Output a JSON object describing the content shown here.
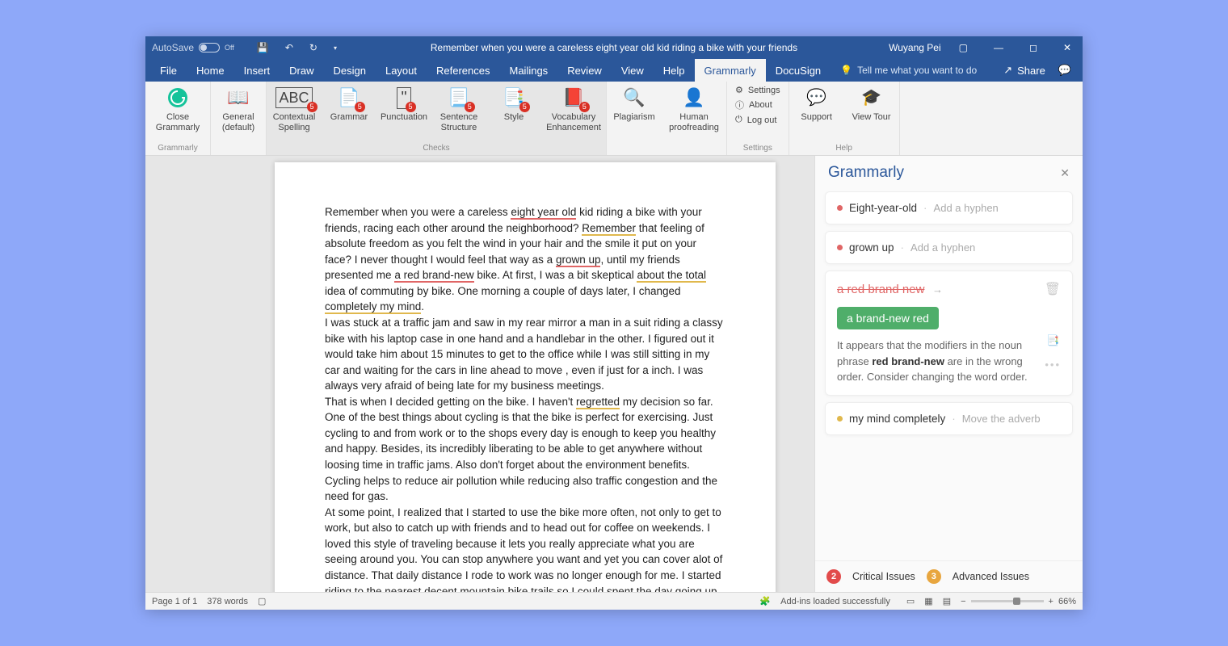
{
  "titlebar": {
    "autosave_label": "AutoSave",
    "autosave_state": "Off",
    "doc_title": "Remember when you were a careless eight year old kid riding a bike with your friends",
    "user_name": "Wuyang Pei"
  },
  "tabs": {
    "file": "File",
    "home": "Home",
    "insert": "Insert",
    "draw": "Draw",
    "design": "Design",
    "layout": "Layout",
    "references": "References",
    "mailings": "Mailings",
    "review": "Review",
    "view": "View",
    "help": "Help",
    "grammarly": "Grammarly",
    "docusign": "DocuSign",
    "tellme": "Tell me what you want to do",
    "share": "Share"
  },
  "ribbon": {
    "close_grammarly": "Close Grammarly",
    "grammarly_group": "Grammarly",
    "general_default": "General (default)",
    "contextual_spelling": "Contextual Spelling",
    "grammar": "Grammar",
    "punctuation": "Punctuation",
    "sentence_structure": "Sentence Structure",
    "style": "Style",
    "vocabulary_enhancement": "Vocabulary Enhancement",
    "checks_group": "Checks",
    "plagiarism": "Plagiarism",
    "human_proofreading": "Human proofreading",
    "settings": "Settings",
    "about": "About",
    "logout": "Log out",
    "settings_group": "Settings",
    "support": "Support",
    "view_tour": "View Tour",
    "help_group": "Help",
    "badges": {
      "contextual": "5",
      "grammar": "5",
      "punctuation": "5",
      "sentence": "5",
      "style": "5",
      "vocab": "5"
    }
  },
  "document": {
    "p1a": "Remember when you were a careless ",
    "p1_err1": "eight year old",
    "p1b": " kid riding a bike with your friends, racing each other around the neighborhood? ",
    "p1_err2": "Remember",
    "p1c": " that feeling of absolute freedom as you felt the wind in your hair and the smile it put on your face? I never thought I would feel that way as a ",
    "p1_err3": "grown up",
    "p1d": ", until my friends presented me ",
    "p1_err4": "a red brand-new",
    "p1e": " bike. At first, I was a bit skeptical ",
    "p1_err5": "about the total",
    "p1f": " idea of commuting by bike. One morning a couple of days later, I changed ",
    "p1_err6": "completely my mind",
    "p1g": ".",
    "p2": "I was stuck at a traffic jam and saw in my rear mirror a man in a suit riding a classy bike with his laptop case in one hand and a handlebar in the other. I figured out it would take him about 15 minutes to get to the office while I was still sitting in my car and waiting for the cars in line ahead to move , even if just for a inch. I was always very afraid of being late for my business meetings.",
    "p3a": "That is when I decided getting on the bike. I haven't ",
    "p3_err": "regretted",
    "p3b": " my decision so far. One of the best things about cycling is that the bike is perfect for exercising. Just cycling to and from work or to the shops every day is enough to keep you healthy and happy. Besides, its incredibly liberating to be able to get anywhere without loosing time in traffic jams. Also don't forget about the environment benefits. Cycling helps to reduce air pollution while reducing also traffic congestion and the need for gas.",
    "p4": "At some point, I realized that I started to use the bike more often, not only to get to work, but also to catch up with friends and to head out for coffee on weekends. I loved this style of traveling because it lets you really appreciate what you are seeing around you. You can stop anywhere you want and yet you can cover alot of distance. That daily distance I rode to work was no longer enough for me. I started riding to the nearest decent mountain bike trails so I could spent the day going up and down hills. I did it because it was fun. Because I enjoyed it."
  },
  "gpanel": {
    "title": "Grammarly",
    "card1": {
      "text": "Eight-year-old",
      "hint": "Add a hyphen"
    },
    "card2": {
      "text": "grown up",
      "hint": "Add a hyphen"
    },
    "card3": {
      "strike": "a red brand new",
      "suggest": "a brand-new red",
      "expl_a": "It appears that the modifiers in the noun phrase ",
      "expl_b": "red brand-new",
      "expl_c": " are in the wrong order. Consider changing the word order."
    },
    "card4": {
      "text": "my mind completely",
      "hint": "Move the adverb"
    },
    "footer": {
      "critical_count": "2",
      "critical_label": "Critical Issues",
      "advanced_count": "3",
      "advanced_label": "Advanced Issues"
    }
  },
  "status": {
    "page": "Page 1 of 1",
    "words": "378 words",
    "addins": "Add-ins loaded successfully",
    "zoom": "66%"
  }
}
